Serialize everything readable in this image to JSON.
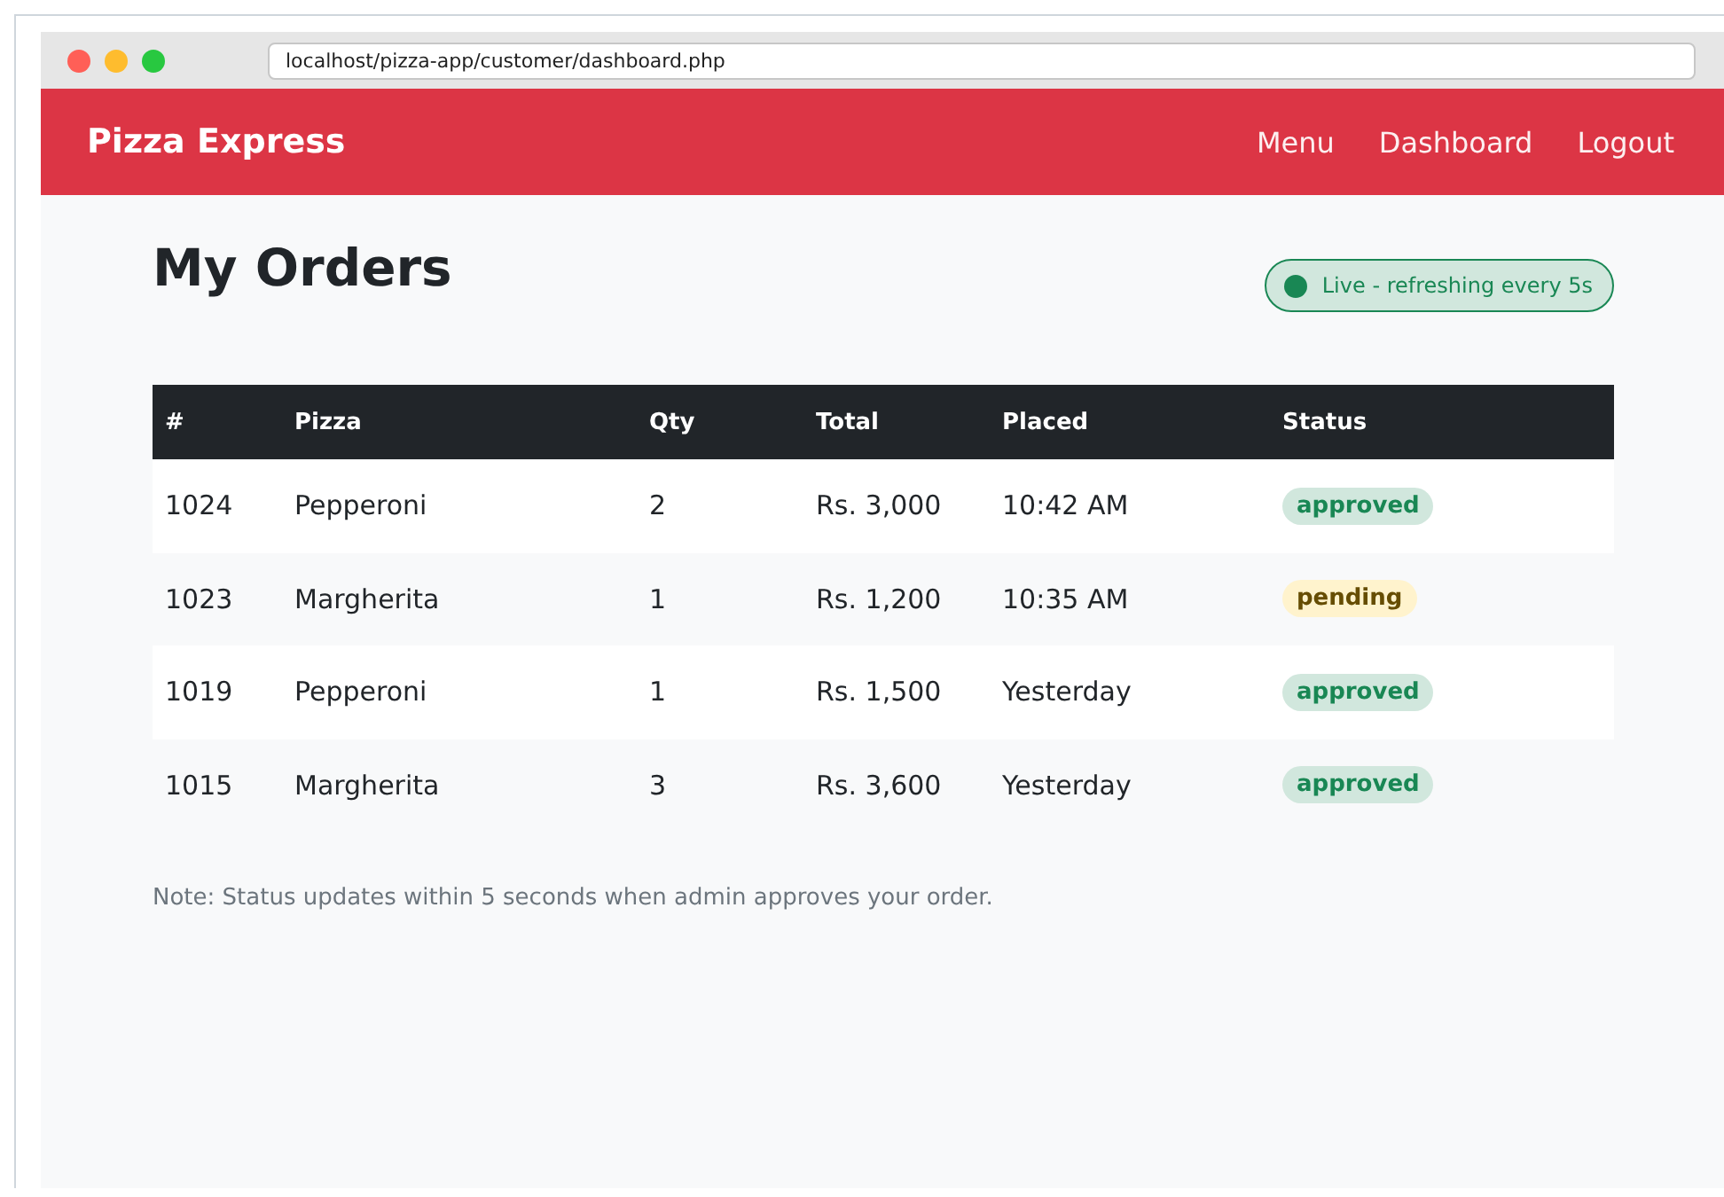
{
  "browser": {
    "address": "localhost/pizza-app/customer/dashboard.php"
  },
  "navbar": {
    "brand": "Pizza Express",
    "links": [
      "Menu",
      "Dashboard",
      "Logout"
    ]
  },
  "page": {
    "title": "My Orders",
    "live_badge": "Live - refreshing every 5s"
  },
  "table": {
    "columns": [
      "#",
      "Pizza",
      "Qty",
      "Total",
      "Placed",
      "Status"
    ],
    "rows": [
      {
        "id": "1024",
        "pizza": "Pepperoni",
        "qty": "2",
        "total": "Rs. 3,000",
        "placed": "10:42 AM",
        "status": {
          "label": "approved",
          "kind": "approved"
        }
      },
      {
        "id": "1023",
        "pizza": "Margherita",
        "qty": "1",
        "total": "Rs. 1,200",
        "placed": "10:35 AM",
        "status": {
          "label": "pending",
          "kind": "pending"
        }
      },
      {
        "id": "1019",
        "pizza": "Pepperoni",
        "qty": "1",
        "total": "Rs. 1,500",
        "placed": "Yesterday",
        "status": {
          "label": "approved",
          "kind": "approved"
        }
      },
      {
        "id": "1015",
        "pizza": "Margherita",
        "qty": "3",
        "total": "Rs. 3,600",
        "placed": "Yesterday",
        "status": {
          "label": "approved",
          "kind": "approved"
        }
      }
    ]
  },
  "note": "Note: Status updates within 5 seconds when admin approves your order."
}
